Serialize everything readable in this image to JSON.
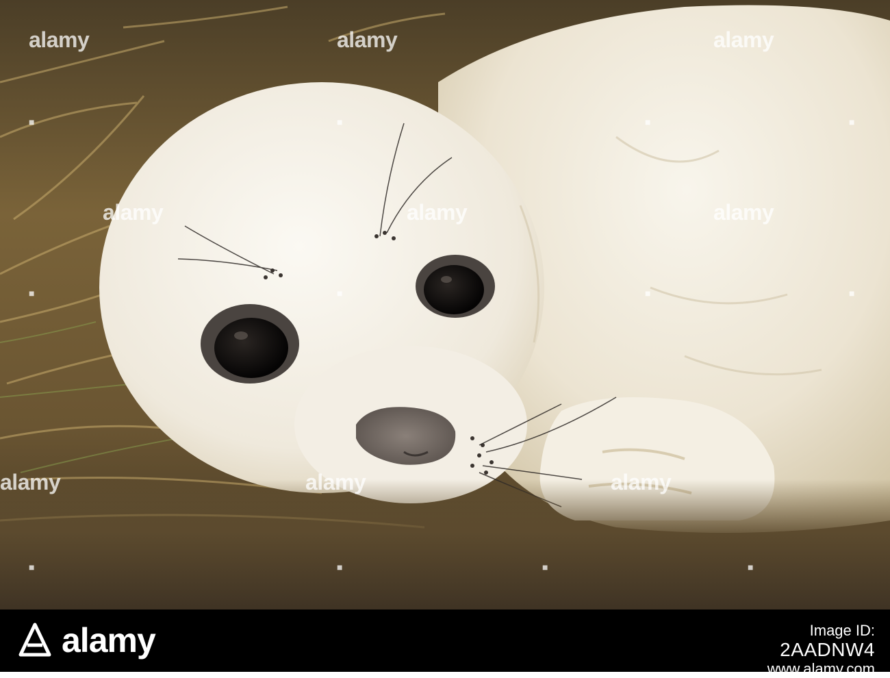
{
  "photo": {
    "subject": "grey seal pup",
    "colors": {
      "grass_dark": "#5b4a2e",
      "grass_light": "#b69a5d",
      "fur_white": "#f1ece0",
      "fur_shadow": "#d4ccb6",
      "eye": "#0d0b0a",
      "nose": "#6e6560"
    }
  },
  "watermarks": {
    "text": "alamy"
  },
  "footer": {
    "brand": "alamy",
    "image_id_label": "Image ID:",
    "image_id": "2AADNW4",
    "url": "www.alamy.com",
    "background": "#000000"
  }
}
